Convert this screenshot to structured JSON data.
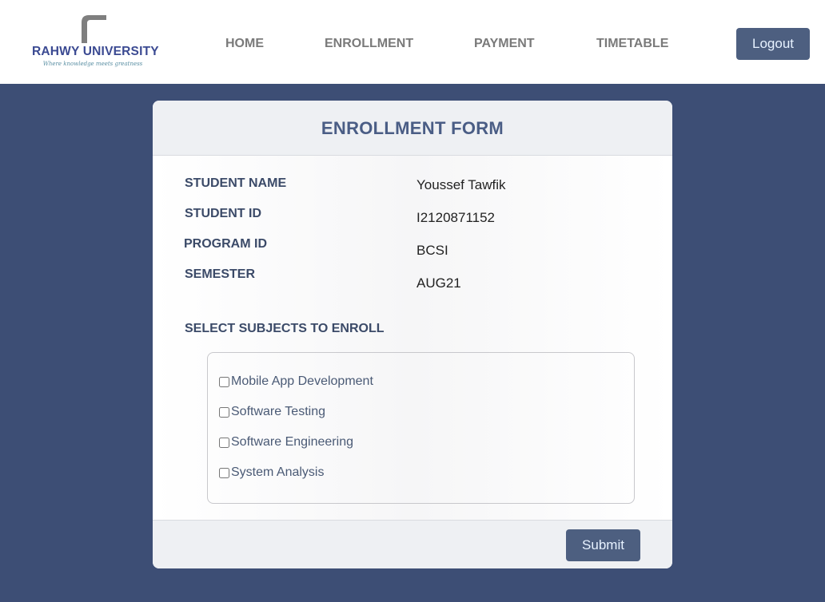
{
  "brand": {
    "name": "RAHWY UNIVERSITY",
    "tagline": "Where knowledge meets greatness",
    "logo_icon": "pipe-elbow-icon"
  },
  "nav": {
    "home": "HOME",
    "enrollment": "ENROLLMENT",
    "payment": "PAYMENT",
    "timetable": "TIMETABLE",
    "logout": "Logout"
  },
  "form": {
    "title": "ENROLLMENT FORM",
    "fields": [
      {
        "label": "STUDENT NAME",
        "value": "Youssef Tawfik"
      },
      {
        "label": "STUDENT ID",
        "value": "I2120871152"
      },
      {
        "label": "PROGRAM ID",
        "value": "BCSI"
      },
      {
        "label": "SEMESTER",
        "value": "AUG21"
      }
    ],
    "subjects_heading": "SELECT SUBJECTS TO ENROLL",
    "subjects": [
      {
        "label": "Mobile App Development",
        "checked": false
      },
      {
        "label": "Software Testing",
        "checked": false
      },
      {
        "label": "Software Engineering",
        "checked": false
      },
      {
        "label": "System Analysis",
        "checked": false
      }
    ],
    "submit": "Submit"
  },
  "colors": {
    "page_background": "#3d4e75",
    "accent_button": "#4d5f80",
    "button_text": "#e7f2ff",
    "heading": "#4a5d85",
    "nav_text": "#7a7a7a",
    "brand_blue": "#3b4a92"
  }
}
